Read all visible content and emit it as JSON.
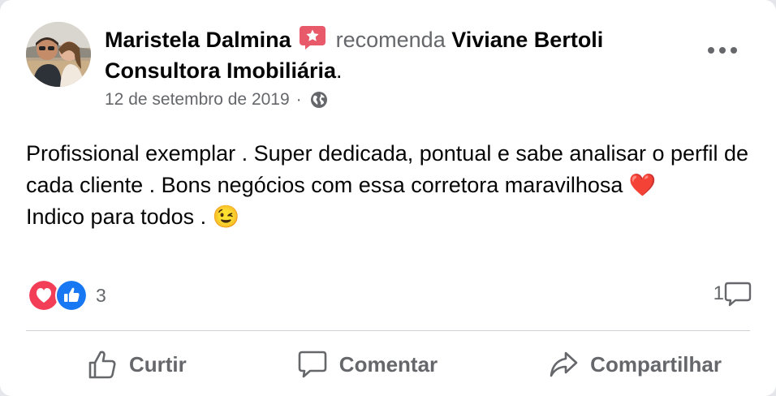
{
  "post": {
    "author": "Maristela Dalmina",
    "verb": "recomenda",
    "target": "Viviane Bertoli Consultora Imobiliária",
    "target_suffix": ".",
    "date": "12 de setembro de 2019",
    "date_sep": "·",
    "privacy_icon": "globe-icon",
    "body_lines": [
      "Profissional exemplar . Super dedicada, pontual e sabe analisar o perfil de cada cliente . Bons negócios com essa corretora maravilhosa ❤️",
      "Indico para todos . 😉"
    ]
  },
  "engagement": {
    "reaction_icons": [
      "love-reaction-icon",
      "like-reaction-icon"
    ],
    "reaction_count": "3",
    "comment_count": "1"
  },
  "actions": {
    "like_label": "Curtir",
    "comment_label": "Comentar",
    "share_label": "Compartilhar"
  },
  "colors": {
    "text": "#050505",
    "secondary": "#65676b",
    "love": "#f33e58",
    "like": "#1877f2",
    "recommend_badge": "#e85a6a",
    "divider": "#ced0d4"
  }
}
